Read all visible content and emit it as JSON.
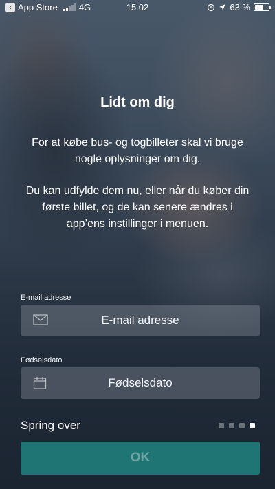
{
  "status_bar": {
    "back_app": "App Store",
    "network": "4G",
    "time": "15.02",
    "battery": "63 %",
    "battery_level": 0.63
  },
  "onboarding": {
    "title": "Lidt om dig",
    "intro": "For at købe bus- og togbilleter skal vi bruge nogle oplysninger om dig.",
    "intro2": "Du kan udfylde dem nu, eller når du køber din første billet, og de kan senere ændres i app’ens instillinger i menuen."
  },
  "form": {
    "email_label": "E-mail adresse",
    "email_placeholder": "E-mail adresse",
    "birth_label": "Fødselsdato",
    "birth_placeholder": "Fødselsdato"
  },
  "footer": {
    "skip_label": "Spring over",
    "ok_label": "OK",
    "page_count": 4,
    "current_page": 4
  },
  "colors": {
    "ok_button": "#1f7573",
    "field_bg": "rgba(220,225,232,0.22)"
  }
}
